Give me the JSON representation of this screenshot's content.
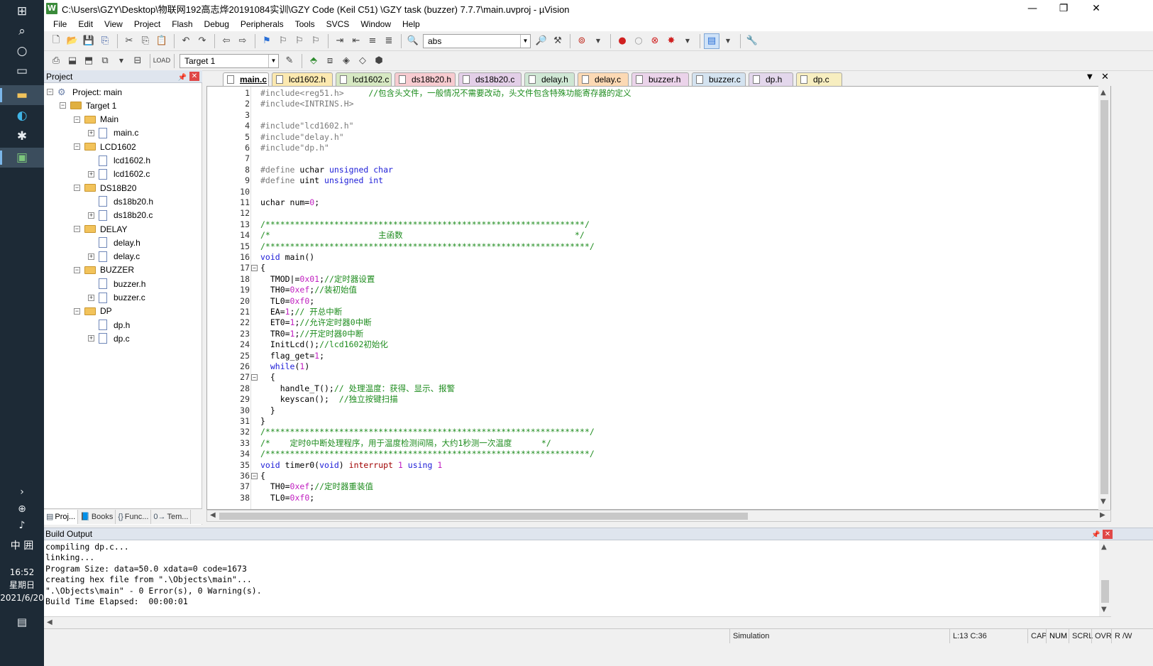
{
  "taskbar": {
    "time": "16:52",
    "weekday": "星期日",
    "date": "2021/6/20",
    "ime_lang": "中",
    "ime_mode": "囲"
  },
  "titlebar": {
    "title": "C:\\Users\\GZY\\Desktop\\物联网192高志烨20191084实训\\GZY Code   (Keil C51)  \\GZY task (buzzer) 7.7.7\\main.uvproj - µVision",
    "minimize": "—",
    "restore": "❐",
    "close": "✕"
  },
  "menubar": [
    "File",
    "Edit",
    "View",
    "Project",
    "Flash",
    "Debug",
    "Peripherals",
    "Tools",
    "SVCS",
    "Window",
    "Help"
  ],
  "toolbar1": {
    "find_value": "abs"
  },
  "toolbar2": {
    "target": "Target 1"
  },
  "project_panel": {
    "title": "Project",
    "tree": [
      {
        "label": "Project: main",
        "level": 0,
        "kind": "project",
        "exp": "⊟"
      },
      {
        "label": "Target 1",
        "level": 1,
        "kind": "target",
        "exp": "⊟"
      },
      {
        "label": "Main",
        "level": 2,
        "kind": "folder",
        "exp": "⊟"
      },
      {
        "label": "main.c",
        "level": 3,
        "kind": "file",
        "exp": "⊞"
      },
      {
        "label": "LCD1602",
        "level": 2,
        "kind": "folder",
        "exp": "⊟"
      },
      {
        "label": "lcd1602.h",
        "level": 3,
        "kind": "file",
        "exp": ""
      },
      {
        "label": "lcd1602.c",
        "level": 3,
        "kind": "file",
        "exp": "⊞"
      },
      {
        "label": "DS18B20",
        "level": 2,
        "kind": "folder",
        "exp": "⊟"
      },
      {
        "label": "ds18b20.h",
        "level": 3,
        "kind": "file",
        "exp": ""
      },
      {
        "label": "ds18b20.c",
        "level": 3,
        "kind": "file",
        "exp": "⊞"
      },
      {
        "label": "DELAY",
        "level": 2,
        "kind": "folder",
        "exp": "⊟"
      },
      {
        "label": "delay.h",
        "level": 3,
        "kind": "file",
        "exp": ""
      },
      {
        "label": "delay.c",
        "level": 3,
        "kind": "file",
        "exp": "⊞"
      },
      {
        "label": "BUZZER",
        "level": 2,
        "kind": "folder",
        "exp": "⊟"
      },
      {
        "label": "buzzer.h",
        "level": 3,
        "kind": "file",
        "exp": ""
      },
      {
        "label": "buzzer.c",
        "level": 3,
        "kind": "file",
        "exp": "⊞"
      },
      {
        "label": "DP",
        "level": 2,
        "kind": "folder",
        "exp": "⊟"
      },
      {
        "label": "dp.h",
        "level": 3,
        "kind": "file",
        "exp": ""
      },
      {
        "label": "dp.c",
        "level": 3,
        "kind": "file",
        "exp": "⊞"
      }
    ],
    "bottom_tabs": [
      "Proj...",
      "Books",
      "Func...",
      "Tem..."
    ]
  },
  "editor_tabs": [
    {
      "label": "main.c",
      "color": "#ffffff",
      "selected": true
    },
    {
      "label": "lcd1602.h",
      "color": "#fce9b0"
    },
    {
      "label": "lcd1602.c",
      "color": "#d6e8c2"
    },
    {
      "label": "ds18b20.h",
      "color": "#f7cbd0"
    },
    {
      "label": "ds18b20.c",
      "color": "#e3cfe8"
    },
    {
      "label": "delay.h",
      "color": "#cfe7d4"
    },
    {
      "label": "delay.c",
      "color": "#fcd9b4"
    },
    {
      "label": "buzzer.h",
      "color": "#ebd3ea"
    },
    {
      "label": "buzzer.c",
      "color": "#d4e3f0"
    },
    {
      "label": "dp.h",
      "color": "#e3d7ec"
    },
    {
      "label": "dp.c",
      "color": "#f7eec0"
    }
  ],
  "code": [
    [
      [
        "pp",
        "#include<reg51.h>     "
      ],
      [
        "cm",
        "//包含头文件，一般情况不需要改动，头文件包含特殊功能寄存器的定义"
      ]
    ],
    [
      [
        "pp",
        "#include<INTRINS.H>"
      ]
    ],
    [],
    [
      [
        "pp",
        "#include\"lcd1602.h\""
      ]
    ],
    [
      [
        "pp",
        "#include\"delay.h\""
      ]
    ],
    [
      [
        "pp",
        "#include\"dp.h\""
      ]
    ],
    [],
    [
      [
        "pp",
        "#define "
      ],
      [
        "n",
        "uchar "
      ],
      [
        "kw",
        "unsigned char"
      ]
    ],
    [
      [
        "pp",
        "#define "
      ],
      [
        "n",
        "uint "
      ],
      [
        "kw",
        "unsigned int"
      ]
    ],
    [],
    [
      [
        "n",
        "uchar num="
      ],
      [
        "num",
        "0"
      ],
      [
        "n",
        ";"
      ]
    ],
    [],
    [
      [
        "cm",
        "/*****************************************************************/"
      ]
    ],
    [
      [
        "cm",
        "/*                      主函数                                   */"
      ]
    ],
    [
      [
        "cm",
        "/******************************************************************/"
      ]
    ],
    [
      [
        "kw",
        "void "
      ],
      [
        "n",
        "main()"
      ]
    ],
    [
      [
        "n",
        "{"
      ]
    ],
    [
      [
        "n",
        "  TMOD|="
      ],
      [
        "num",
        "0x01"
      ],
      [
        "n",
        ";"
      ],
      [
        "cm",
        "//定时器设置"
      ]
    ],
    [
      [
        "n",
        "  TH0="
      ],
      [
        "num",
        "0xef"
      ],
      [
        "n",
        ";"
      ],
      [
        "cm",
        "//装初始值"
      ]
    ],
    [
      [
        "n",
        "  TL0="
      ],
      [
        "num",
        "0xf0"
      ],
      [
        "n",
        ";"
      ]
    ],
    [
      [
        "n",
        "  EA="
      ],
      [
        "num",
        "1"
      ],
      [
        "n",
        ";"
      ],
      [
        "cm",
        "// 开总中断"
      ]
    ],
    [
      [
        "n",
        "  ET0="
      ],
      [
        "num",
        "1"
      ],
      [
        "n",
        ";"
      ],
      [
        "cm",
        "//允许定时器0中断"
      ]
    ],
    [
      [
        "n",
        "  TR0="
      ],
      [
        "num",
        "1"
      ],
      [
        "n",
        ";"
      ],
      [
        "cm",
        "//开定时器0中断"
      ]
    ],
    [
      [
        "n",
        "  InitLcd();"
      ],
      [
        "cm",
        "//lcd1602初始化"
      ]
    ],
    [
      [
        "n",
        "  flag_get="
      ],
      [
        "num",
        "1"
      ],
      [
        "n",
        ";"
      ]
    ],
    [
      [
        "kw",
        "  while"
      ],
      [
        "n",
        "("
      ],
      [
        "num",
        "1"
      ],
      [
        "n",
        ")"
      ]
    ],
    [
      [
        "n",
        "  {"
      ]
    ],
    [
      [
        "n",
        "    handle_T();"
      ],
      [
        "cm",
        "// 处理温度：获得、显示、报警"
      ]
    ],
    [
      [
        "n",
        "    keyscan();  "
      ],
      [
        "cm",
        "//独立按键扫描"
      ]
    ],
    [
      [
        "n",
        "  }"
      ]
    ],
    [
      [
        "n",
        "}"
      ]
    ],
    [
      [
        "cm",
        "/******************************************************************/"
      ]
    ],
    [
      [
        "cm",
        "/*    定时0中断处理程序，用于温度检测间隔，大约1秒测一次温度      */"
      ]
    ],
    [
      [
        "cm",
        "/******************************************************************/"
      ]
    ],
    [
      [
        "kw",
        "void "
      ],
      [
        "n",
        "timer0("
      ],
      [
        "kw",
        "void"
      ],
      [
        "n",
        ") "
      ],
      [
        "int",
        "interrupt "
      ],
      [
        "num",
        "1 "
      ],
      [
        "kw",
        "using "
      ],
      [
        "num",
        "1"
      ]
    ],
    [
      [
        "n",
        "{"
      ]
    ],
    [
      [
        "n",
        "  TH0="
      ],
      [
        "num",
        "0xef"
      ],
      [
        "n",
        ";"
      ],
      [
        "cm",
        "//定时器重装值"
      ]
    ],
    [
      [
        "n",
        "  TL0="
      ],
      [
        "num",
        "0xf0"
      ],
      [
        "n",
        ";"
      ]
    ]
  ],
  "fold_marks": {
    "17": "⊟",
    "27": "⊟",
    "36": "⊟"
  },
  "build_output": {
    "title": "Build Output",
    "lines": [
      "compiling dp.c...",
      "linking...",
      "Program Size: data=50.0 xdata=0 code=1673",
      "creating hex file from \".\\Objects\\main\"...",
      "\".\\Objects\\main\" - 0 Error(s), 0 Warning(s).",
      "Build Time Elapsed:  00:00:01"
    ]
  },
  "statusbar": {
    "mode": "Simulation",
    "position": "L:13 C:36",
    "cap": "CAP",
    "num": "NUM",
    "scrl": "SCRL",
    "ovr": "OVR",
    "rw": "R /W"
  }
}
